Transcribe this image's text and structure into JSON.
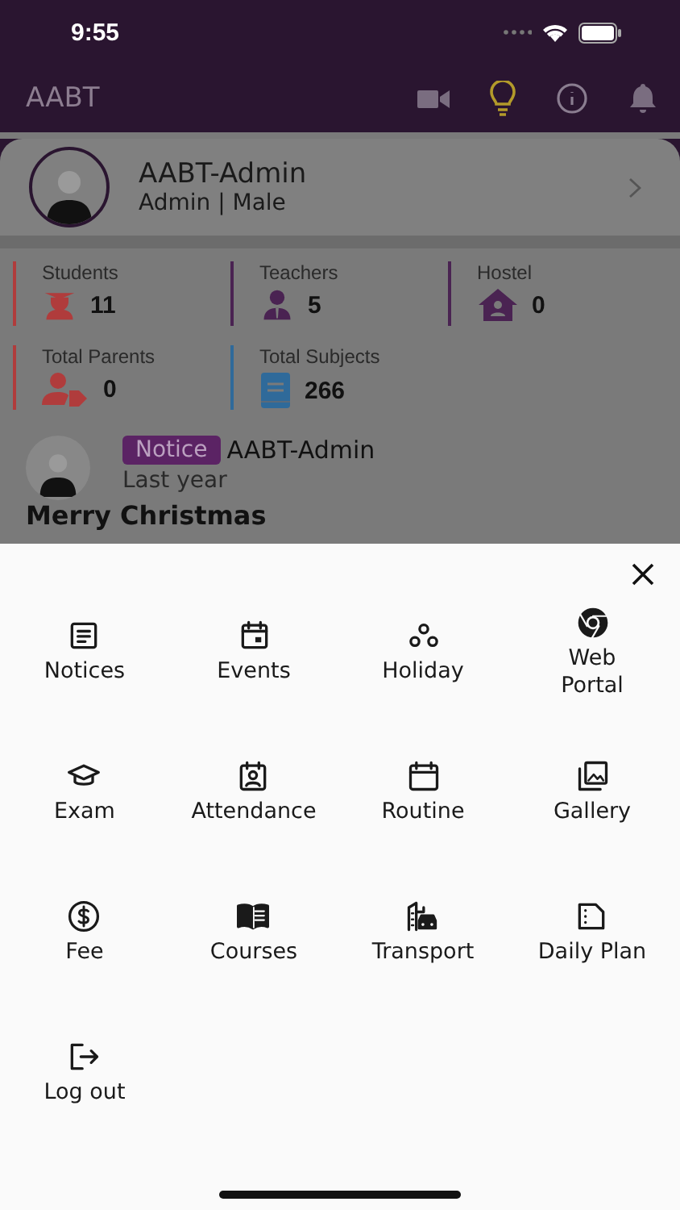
{
  "status_bar": {
    "time": "9:55"
  },
  "app_bar": {
    "title": "AABT"
  },
  "profile": {
    "name": "AABT-Admin",
    "subtitle": "Admin | Male"
  },
  "stats": [
    {
      "label": "Students",
      "value": "11",
      "color": "#b03c3c"
    },
    {
      "label": "Teachers",
      "value": "5",
      "color": "#4a2352"
    },
    {
      "label": "Hostel",
      "value": "0",
      "color": "#4a2352"
    },
    {
      "label": "Total Parents",
      "value": "0",
      "color": "#b03c3c"
    },
    {
      "label": "Total Subjects",
      "value": "266",
      "color": "#2f6a9a"
    }
  ],
  "notice": {
    "badge": "Notice",
    "author": "AABT-Admin",
    "time": "Last year",
    "title": "Merry Christmas"
  },
  "menu": {
    "items": [
      {
        "label": "Notices"
      },
      {
        "label": "Events"
      },
      {
        "label": "Holiday"
      },
      {
        "label": "Web Portal"
      },
      {
        "label": "Exam"
      },
      {
        "label": "Attendance"
      },
      {
        "label": "Routine"
      },
      {
        "label": "Gallery"
      },
      {
        "label": "Fee"
      },
      {
        "label": "Courses"
      },
      {
        "label": "Transport"
      },
      {
        "label": "Daily Plan"
      },
      {
        "label": "Log out"
      }
    ]
  }
}
